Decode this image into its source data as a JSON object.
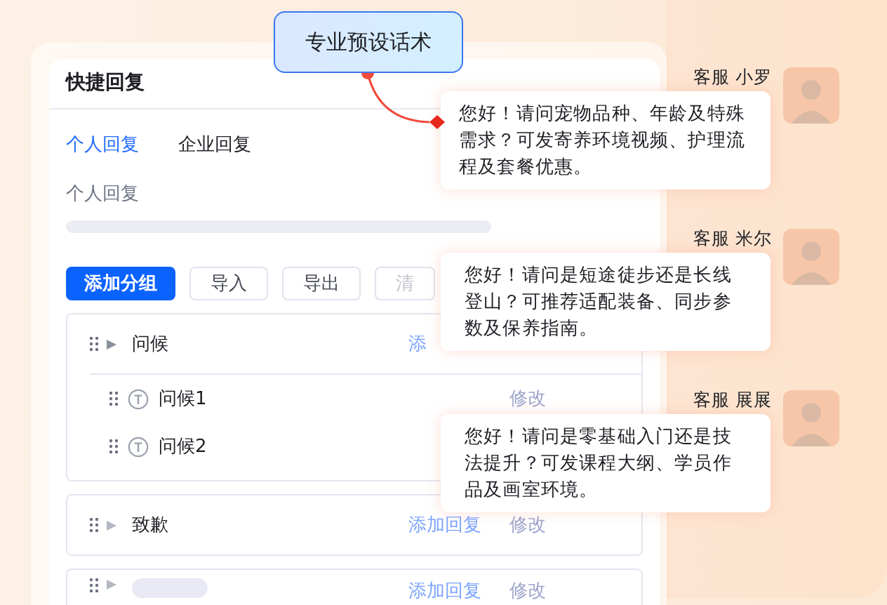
{
  "callout": {
    "label": "专业预设话术"
  },
  "panel": {
    "title": "快捷回复",
    "tabs": [
      {
        "label": "个人回复",
        "selected": true
      },
      {
        "label": "企业回复",
        "selected": false
      }
    ],
    "section_label": "个人回复",
    "toolbar": [
      {
        "label": "添加分组",
        "kind": "primary"
      },
      {
        "label": "导入",
        "kind": "plain"
      },
      {
        "label": "导出",
        "kind": "plain"
      },
      {
        "label": "清",
        "kind": "disabled"
      }
    ],
    "groups": [
      {
        "kind": "named",
        "name": "问候",
        "expanded": true,
        "actions": [
          "添"
        ],
        "children": [
          {
            "name": "问候1",
            "actions": [
              "修改"
            ]
          },
          {
            "name": "问候2"
          }
        ]
      },
      {
        "kind": "named",
        "name": "致歉",
        "expanded": false,
        "actions": [
          "添加回复",
          "修改"
        ]
      },
      {
        "kind": "skeleton",
        "expanded": false,
        "actions": [
          "添加回复",
          "修改"
        ]
      }
    ]
  },
  "agents": [
    {
      "name": "客服 小罗",
      "message": "您好！请问宠物品种、年龄及特殊需求？可发寄养环境视频、护理流程及套餐优惠。",
      "linked": true
    },
    {
      "name": "客服 米尔",
      "message": "您好！请问是短途徒步还是长线登山？可推荐适配装备、同步参数及保养指南。",
      "linked": false
    },
    {
      "name": "客服 展展",
      "message": "您好！请问是零基础入门还是技法提升？可发课程大纲、学员作品及画室环境。",
      "linked": false
    }
  ]
}
